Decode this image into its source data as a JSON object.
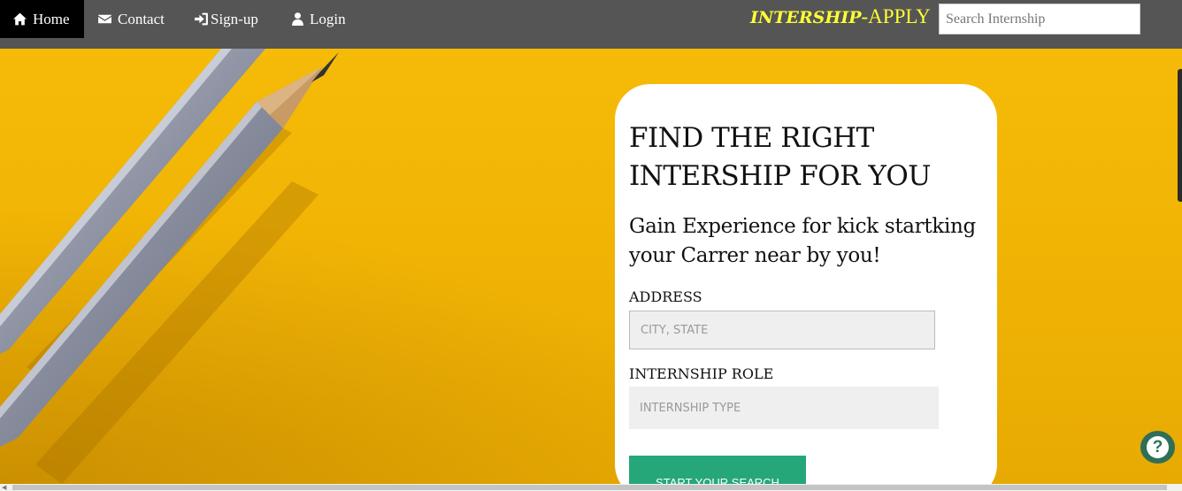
{
  "nav": {
    "items": [
      {
        "label": "Home",
        "icon": "home-icon"
      },
      {
        "label": "Contact",
        "icon": "envelope-icon"
      },
      {
        "label": "Sign-up",
        "icon": "sign-in-icon"
      },
      {
        "label": "Login",
        "icon": "user-icon"
      }
    ],
    "brand_part1": "INTERSHIP",
    "brand_part2": "-APPLY",
    "search_placeholder": "Search Internship"
  },
  "card": {
    "title": "FIND THE RIGHT INTERSHIP FOR YOU",
    "subtitle": "Gain Experience for kick startking your Carrer near by you!",
    "address_label": "ADDRESS",
    "address_placeholder": "CITY, STATE",
    "role_label": "INTERNSHIP ROLE",
    "role_placeholder": "INTERNSHIP TYPE",
    "button_label": "START YOUR SEARCH"
  },
  "help": {
    "label": "?"
  },
  "colors": {
    "navbar": "#555555",
    "active_nav": "#000000",
    "brand": "#ffff33",
    "hero_background": "#f2b705",
    "button": "#26a77a",
    "help_button": "#2f6f58"
  }
}
